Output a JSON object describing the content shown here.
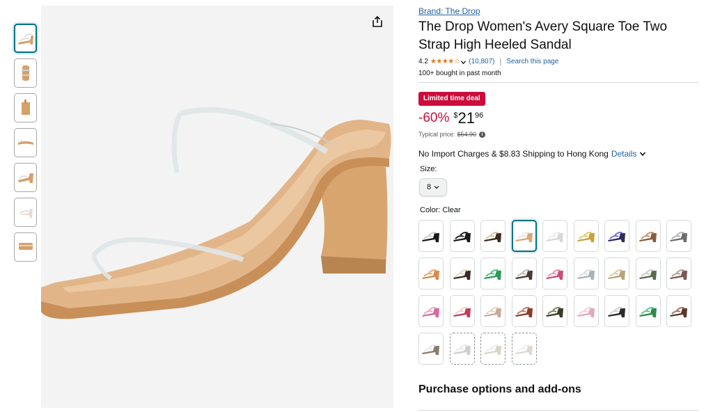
{
  "product": {
    "brand_link": "Brand: The Drop",
    "title": "The Drop Women's Avery Square Toe Two Strap High Heeled Sandal",
    "rating": "4.2",
    "stars_filled": 4.2,
    "rating_count": "(10,807)",
    "search_link": "Search this page",
    "bought_text": "100+ bought in past month"
  },
  "deal": {
    "badge": "Limited time deal",
    "discount": "-60%",
    "currency": "$",
    "price_whole": "21",
    "price_fraction": "96",
    "typical_label": "Typical price:",
    "typical_price": "$54.90",
    "info_icon": "i"
  },
  "shipping": {
    "text": "No Import Charges & $8.83 Shipping to Hong Kong",
    "details_link": "Details"
  },
  "size": {
    "label": "Size:",
    "selected": "8"
  },
  "color": {
    "label": "Color: Clear",
    "selected_index": 3,
    "swatches": [
      {
        "name": "swatch-1",
        "heel": "#1a1a1a",
        "strap": "#cfcfcf",
        "available": true
      },
      {
        "name": "swatch-2",
        "heel": "#1a1a1a",
        "strap": "#222222",
        "available": true
      },
      {
        "name": "swatch-3",
        "heel": "#3b2a20",
        "strap": "#d9c3a5",
        "available": true
      },
      {
        "name": "swatch-4",
        "heel": "#d7a875",
        "strap": "#e5e5e5",
        "available": true
      },
      {
        "name": "swatch-5",
        "heel": "#d8d8d8",
        "strap": "#ececec",
        "available": true
      },
      {
        "name": "swatch-6",
        "heel": "#c9a03a",
        "strap": "#e3c86a",
        "available": true
      },
      {
        "name": "swatch-7",
        "heel": "#2c2c5e",
        "strap": "#7a6cd9",
        "available": true
      },
      {
        "name": "swatch-8",
        "heel": "#8a5c3a",
        "strap": "#c19470",
        "available": true
      },
      {
        "name": "swatch-9",
        "heel": "#6d6d6d",
        "strap": "#b5b5b5",
        "available": true
      },
      {
        "name": "swatch-10",
        "heel": "#d78a4c",
        "strap": "#e9a86e",
        "available": true
      },
      {
        "name": "swatch-11",
        "heel": "#3a2a22",
        "strap": "#e9d8c0",
        "available": true
      },
      {
        "name": "swatch-12",
        "heel": "#2f9a5a",
        "strap": "#53c47f",
        "available": true
      },
      {
        "name": "swatch-13",
        "heel": "#4a3a35",
        "strap": "#c8b6b0",
        "available": true
      },
      {
        "name": "swatch-14",
        "heel": "#c94f7a",
        "strap": "#f08fb4",
        "available": true
      },
      {
        "name": "swatch-15",
        "heel": "#a8b3b8",
        "strap": "#d4dde0",
        "available": true
      },
      {
        "name": "swatch-16",
        "heel": "#b9a37a",
        "strap": "#dccaa2",
        "available": true
      },
      {
        "name": "swatch-17",
        "heel": "#5b6a4e",
        "strap": "#c9c9c9",
        "available": true
      },
      {
        "name": "swatch-18",
        "heel": "#7a5a52",
        "strap": "#b99a93",
        "available": true
      },
      {
        "name": "swatch-19",
        "heel": "#d46aa0",
        "strap": "#f2a4c8",
        "available": true
      },
      {
        "name": "swatch-20",
        "heel": "#c23b5a",
        "strap": "#e2d5d0",
        "available": true
      },
      {
        "name": "swatch-21",
        "heel": "#c9a99b",
        "strap": "#e6d2cb",
        "available": true
      },
      {
        "name": "swatch-22",
        "heel": "#8a3a2a",
        "strap": "#c97a65",
        "available": true
      },
      {
        "name": "swatch-23",
        "heel": "#3a3a2a",
        "strap": "#7a8a5a",
        "available": true
      },
      {
        "name": "swatch-24",
        "heel": "#e0a8b8",
        "strap": "#f4d0da",
        "available": true
      },
      {
        "name": "swatch-25",
        "heel": "#2a2a2a",
        "strap": "#d0d0d0",
        "available": true
      },
      {
        "name": "swatch-26",
        "heel": "#2f8a4a",
        "strap": "#5fc88a",
        "available": true
      },
      {
        "name": "swatch-27",
        "heel": "#5a3a2a",
        "strap": "#a07a5a",
        "available": true
      },
      {
        "name": "swatch-28",
        "heel": "#8a7a6a",
        "strap": "#e8e8e8",
        "available": true
      },
      {
        "name": "swatch-29",
        "heel": "#cfcfcf",
        "strap": "#e8e8e8",
        "available": false
      },
      {
        "name": "swatch-30",
        "heel": "#d9d6c8",
        "strap": "#ececec",
        "available": false
      },
      {
        "name": "swatch-31",
        "heel": "#e0d8d0",
        "strap": "#f0f0f0",
        "available": false
      }
    ]
  },
  "purchase": {
    "title": "Purchase options and add-ons"
  },
  "colors": {
    "link": "#2162a1",
    "deal_red": "#cc0c39",
    "star_orange": "#de7921",
    "selected_border": "#007185",
    "heel_tan": "#d6a06a"
  },
  "icons": {
    "share": "share-icon",
    "chevron": "chevron-down-icon",
    "info": "info-icon"
  }
}
